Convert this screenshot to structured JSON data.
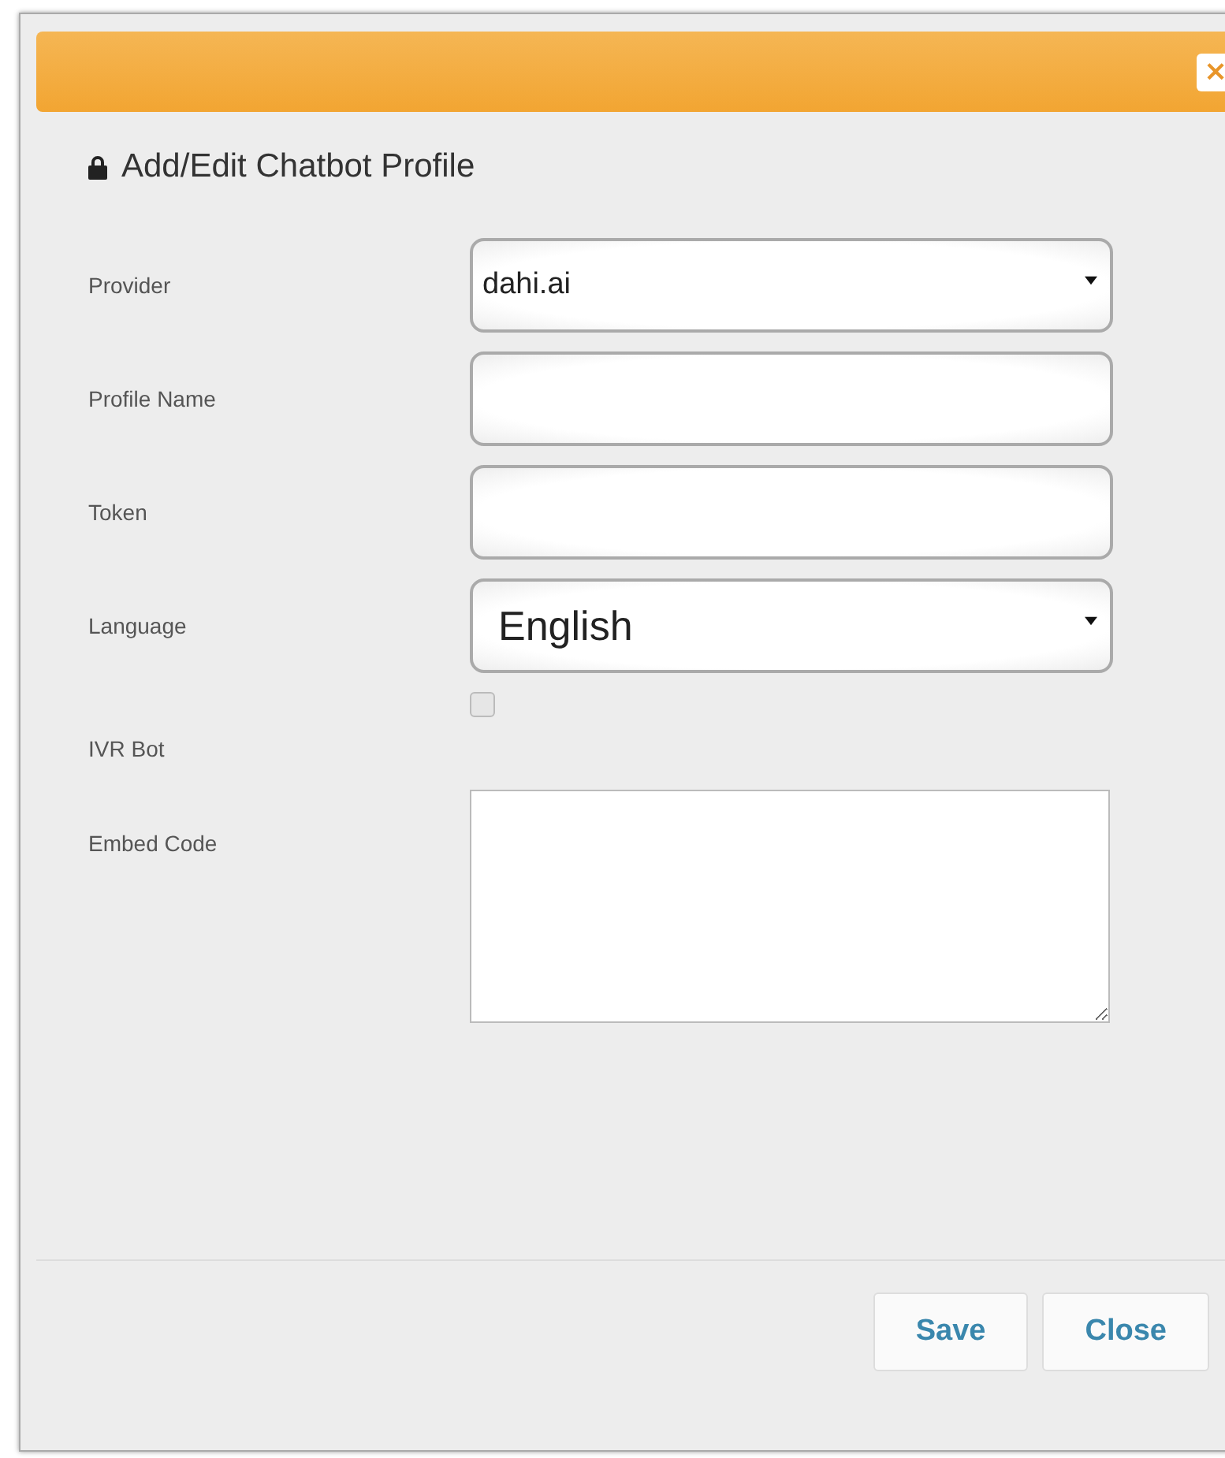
{
  "dialog": {
    "title": "Add/Edit Chatbot Profile",
    "close_symbol": "×"
  },
  "fields": [
    {
      "label": "Provider",
      "kind": "select",
      "value": "dahi.ai",
      "large_text": false
    },
    {
      "label": "Profile Name",
      "kind": "text"
    },
    {
      "label": "Token",
      "kind": "text"
    },
    {
      "label": "Language",
      "kind": "select",
      "value": "English",
      "large_text": true
    },
    {
      "label": "IVR Bot",
      "kind": "checkbox",
      "checked": false
    },
    {
      "label": "Embed Code",
      "kind": "textarea"
    }
  ],
  "buttons": [
    "Save",
    "Close"
  ]
}
